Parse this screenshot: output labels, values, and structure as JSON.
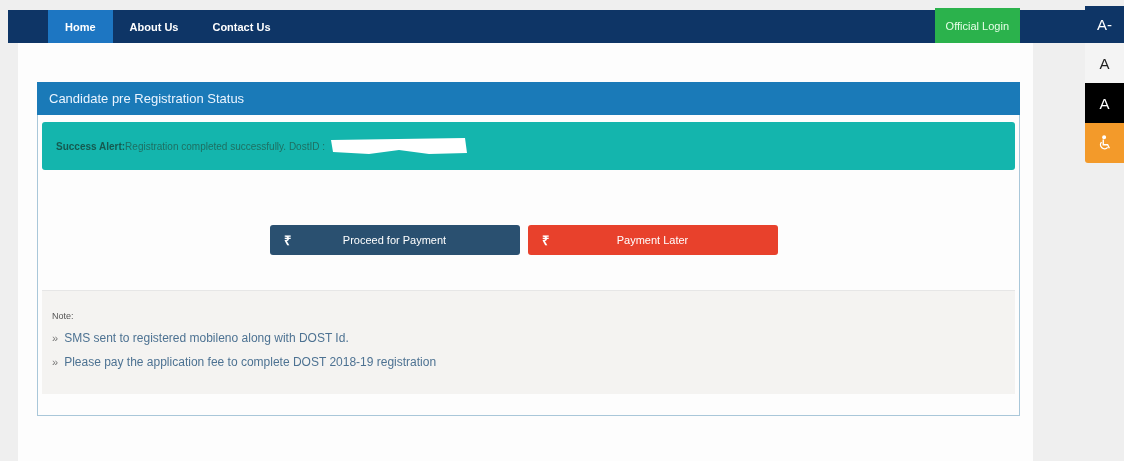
{
  "nav": {
    "items": [
      {
        "label": "Home",
        "selected": true
      },
      {
        "label": "About Us",
        "selected": false
      },
      {
        "label": "Contact Us",
        "selected": false
      }
    ],
    "login_button": "Official Login"
  },
  "accessibility": [
    {
      "kind": "decrease",
      "label": "A-"
    },
    {
      "kind": "normal",
      "label": "A"
    },
    {
      "kind": "contrast",
      "label": "A"
    },
    {
      "kind": "wheelchair"
    }
  ],
  "panel": {
    "title": "Candidate pre Registration Status",
    "alert": {
      "label": "Success Alert:",
      "message": "Registration completed successfully. DostID :",
      "redacted": true
    },
    "buttons": [
      {
        "kind": "primary",
        "icon": "₹",
        "label": "Proceed for Payment"
      },
      {
        "kind": "danger",
        "icon": "₹",
        "label": "Payment Later"
      }
    ],
    "note": {
      "title": "Note:",
      "items": [
        {
          "bullet": "»",
          "text": "SMS sent to registered mobileno along with DOST Id."
        },
        {
          "bullet": "»",
          "text": "Please pay the application fee to complete DOST 2018-19 registration"
        }
      ]
    }
  }
}
